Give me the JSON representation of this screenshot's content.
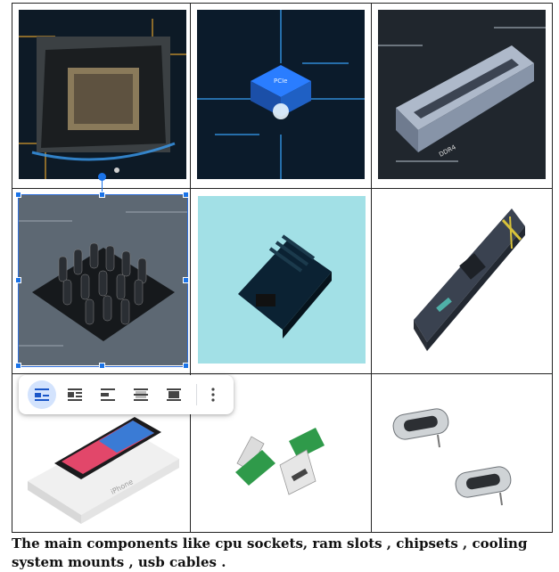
{
  "document": {
    "caption": "The main components like cpu sockets, ram slots , chipsets , cooling system mounts , usb cables ."
  },
  "images": [
    {
      "name": "cpu-socket-image",
      "icon": "cpu-socket-photo"
    },
    {
      "name": "chipset-image",
      "icon": "chip-photo",
      "label": "PCIe"
    },
    {
      "name": "ram-slot-image",
      "icon": "ram-slot-photo",
      "label": "DDR4"
    },
    {
      "name": "cooling-mount-image",
      "icon": "pin-array-photo"
    },
    {
      "name": "module-board-image",
      "icon": "heatsink-module-photo"
    },
    {
      "name": "motherboard-image",
      "icon": "motherboard-render"
    },
    {
      "name": "iphone-box-image",
      "icon": "phone-box-photo",
      "label": "iPhone"
    },
    {
      "name": "usb-plug-image",
      "icon": "usb-c-plug-photo"
    },
    {
      "name": "usb-port-image",
      "icon": "usb-c-port-photo"
    }
  ],
  "toolbar": {
    "options": [
      "in-line",
      "wrap-text",
      "break-text",
      "behind-text",
      "in-front-of-text"
    ],
    "active": "in-line",
    "more": "more-options"
  },
  "colors": {
    "selection": "#1a73e8",
    "active_bg": "#d3e3fd"
  }
}
